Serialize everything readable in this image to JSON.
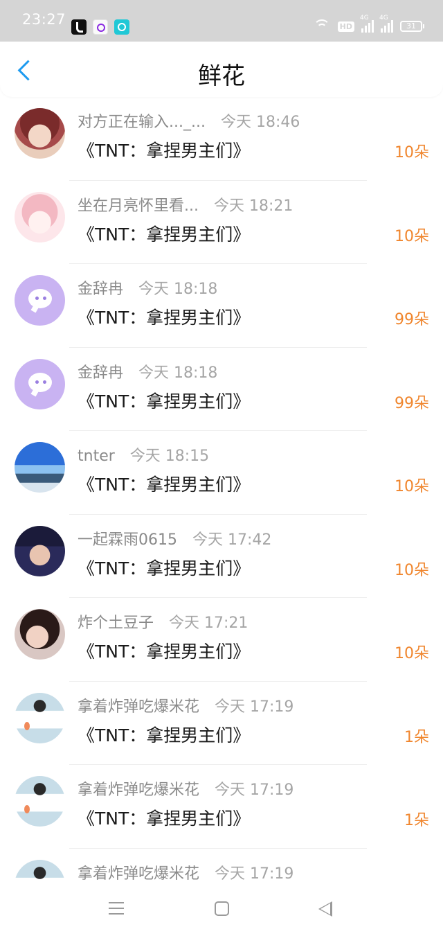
{
  "status_bar": {
    "time": "23:27",
    "app_icons": [
      "tiktok-icon",
      "app-icon",
      "app-icon"
    ],
    "hd_label": "HD",
    "signal_1": "4G",
    "signal_2": "4G",
    "battery": "31"
  },
  "header": {
    "title": "鲜花",
    "back_icon": "chevron-left-icon",
    "accent_color": "#1e9bf0"
  },
  "records": [
    {
      "name": "对方正在输入..._...",
      "time": "今天 18:46",
      "gift": "《TNT：拿捏男主们》",
      "count": "10朵",
      "avatar": "anime1"
    },
    {
      "name": "坐在月亮怀里看...",
      "time": "今天 18:21",
      "gift": "《TNT：拿捏男主们》",
      "count": "10朵",
      "avatar": "anime2"
    },
    {
      "name": "金辞冉",
      "time": "今天 18:18",
      "gift": "《TNT：拿捏男主们》",
      "count": "99朵",
      "avatar": "bubble"
    },
    {
      "name": "金辞冉",
      "time": "今天 18:18",
      "gift": "《TNT：拿捏男主们》",
      "count": "99朵",
      "avatar": "bubble"
    },
    {
      "name": "tnter",
      "time": "今天 18:15",
      "gift": "《TNT：拿捏男主们》",
      "count": "10朵",
      "avatar": "sky"
    },
    {
      "name": "一起霖雨0615",
      "time": "今天 17:42",
      "gift": "《TNT：拿捏男主们》",
      "count": "10朵",
      "avatar": "boy"
    },
    {
      "name": "炸个土豆子",
      "time": "今天 17:21",
      "gift": "《TNT：拿捏男主们》",
      "count": "10朵",
      "avatar": "girl"
    },
    {
      "name": "拿着炸弹吃爆米花",
      "time": "今天 17:19",
      "gift": "《TNT：拿捏男主们》",
      "count": "1朵",
      "avatar": "draw"
    },
    {
      "name": "拿着炸弹吃爆米花",
      "time": "今天 17:19",
      "gift": "《TNT：拿捏男主们》",
      "count": "1朵",
      "avatar": "draw"
    },
    {
      "name": "拿着炸弹吃爆米花",
      "time": "今天 17:19",
      "gift": "",
      "count": "",
      "avatar": "draw"
    }
  ],
  "colors": {
    "count": "#f0862e",
    "name": "#8a8a8a",
    "time": "#a5a5a5",
    "gift": "#1a1a1a"
  },
  "nav_bar": {
    "icons": [
      "menu-icon",
      "home-icon",
      "back-triangle-icon"
    ]
  }
}
